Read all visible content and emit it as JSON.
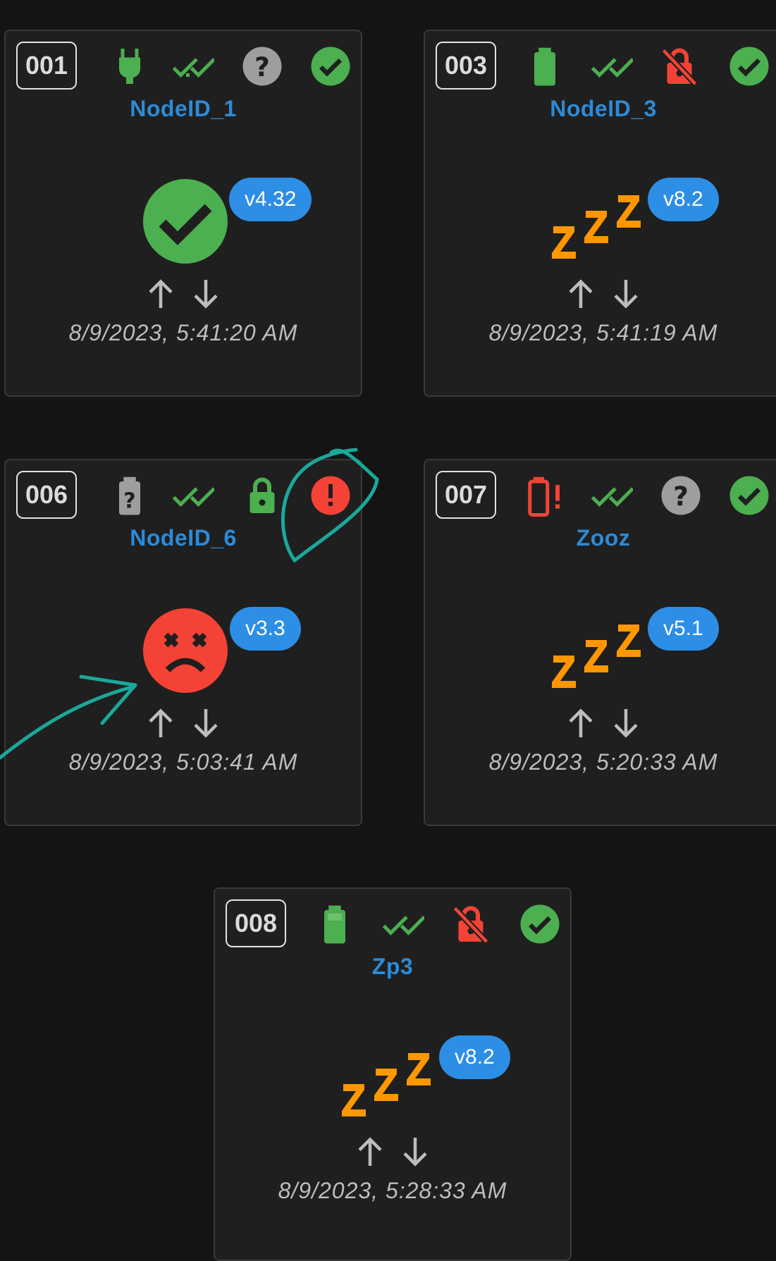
{
  "nodes": [
    {
      "id": "001",
      "name": "NodeID_1",
      "version": "v4.32",
      "timestamp": "8/9/2023, 5:41:20 AM",
      "power_icon": "plug-icon",
      "status_icon": "double-check-icon",
      "security_icon": "help-circle-icon",
      "ready_icon": "check-circle-icon",
      "state_icon": "alive-check-icon",
      "arrows": [
        "arrow-up-icon",
        "arrow-down-icon"
      ]
    },
    {
      "id": "003",
      "name": "NodeID_3",
      "version": "v8.2",
      "timestamp": "8/9/2023, 5:41:19 AM",
      "power_icon": "battery-full-icon",
      "status_icon": "double-check-icon",
      "security_icon": "lock-off-icon",
      "ready_icon": "check-circle-icon",
      "state_icon": "sleep-zzz-icon",
      "arrows": [
        "arrow-up-icon",
        "arrow-down-icon"
      ]
    },
    {
      "id": "006",
      "name": "NodeID_6",
      "version": "v3.3",
      "timestamp": "8/9/2023, 5:03:41 AM",
      "power_icon": "battery-unknown-icon",
      "status_icon": "double-check-icon",
      "security_icon": "lock-icon",
      "ready_icon": "alert-circle-icon",
      "state_icon": "dead-face-icon",
      "arrows": [
        "arrow-up-icon",
        "arrow-down-icon"
      ]
    },
    {
      "id": "007",
      "name": "Zooz",
      "version": "v5.1",
      "timestamp": "8/9/2023, 5:20:33 AM",
      "power_icon": "battery-alert-icon",
      "status_icon": "double-check-icon",
      "security_icon": "help-circle-icon",
      "ready_icon": "check-circle-icon",
      "state_icon": "sleep-zzz-icon",
      "arrows": [
        "arrow-up-icon",
        "arrow-down-icon"
      ]
    },
    {
      "id": "008",
      "name": "Zp3",
      "version": "v8.2",
      "timestamp": "8/9/2023, 5:28:33 AM",
      "power_icon": "battery-full-icon",
      "status_icon": "double-check-icon",
      "security_icon": "lock-off-icon",
      "ready_icon": "check-circle-icon",
      "state_icon": "sleep-zzz-icon",
      "arrows": [
        "arrow-up-icon",
        "arrow-down-icon"
      ]
    }
  ],
  "colors": {
    "background": "#141414",
    "card": "#1f1f1f",
    "card_border": "#393939",
    "name_blue": "#2b8bd8",
    "version_pill": "#2d8ee6",
    "green": "#4caf50",
    "red": "#f44336",
    "orange": "#ff9800",
    "grey": "#9e9e9e",
    "annotation": "#1aa89a"
  }
}
